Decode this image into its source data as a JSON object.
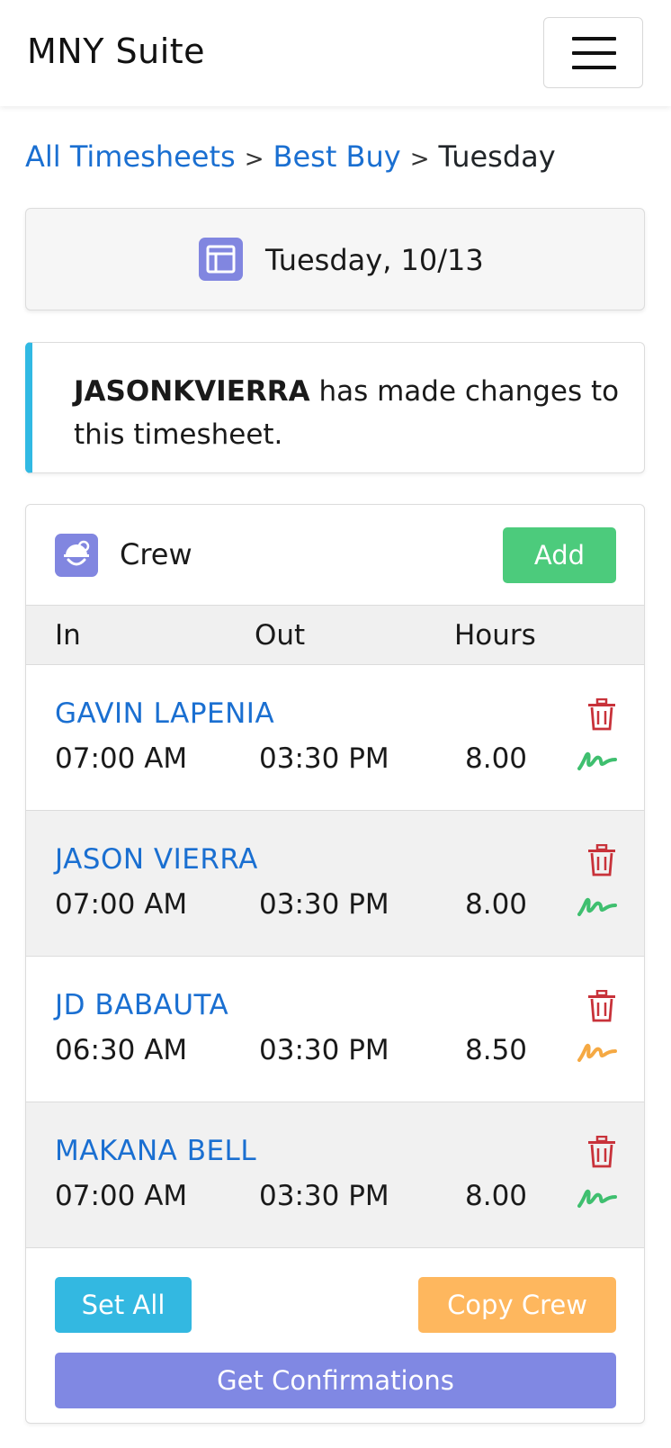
{
  "navbar": {
    "brand": "MNY Suite",
    "menu_icon": "hamburger-icon"
  },
  "breadcrumb": {
    "items": [
      "All Timesheets",
      "Best Buy",
      "Tuesday"
    ],
    "separator": ">"
  },
  "date_card": {
    "icon": "calendar-icon",
    "label": "Tuesday, 10/13"
  },
  "alert": {
    "user": "JASONKVIERRA",
    "message": " has made changes to this timesheet.",
    "accent_color": "#31b9e3"
  },
  "crew": {
    "title": "Crew",
    "icon": "worker-helmet-icon",
    "add_label": "Add",
    "columns": [
      "In",
      "Out",
      "Hours"
    ],
    "rows": [
      {
        "name": "GAVIN LAPENIA",
        "in": "07:00 AM",
        "out": "03:30 PM",
        "hours": "8.00",
        "signature_color": "#3fbf6f"
      },
      {
        "name": "JASON VIERRA",
        "in": "07:00 AM",
        "out": "03:30 PM",
        "hours": "8.00",
        "signature_color": "#3fbf6f"
      },
      {
        "name": "JD BABAUTA",
        "in": "06:30 AM",
        "out": "03:30 PM",
        "hours": "8.50",
        "signature_color": "#f5a943"
      },
      {
        "name": "MAKANA BELL",
        "in": "07:00 AM",
        "out": "03:30 PM",
        "hours": "8.00",
        "signature_color": "#3fbf6f"
      }
    ],
    "buttons": {
      "set_all": "Set All",
      "copy_crew": "Copy Crew",
      "get_confirmations": "Get Confirmations"
    }
  },
  "colors": {
    "link": "#1a6fd1",
    "add": "#4ccb7c",
    "set_all": "#33b8e1",
    "copy_crew": "#feb75e",
    "get_confirmations": "#8088e3",
    "delete": "#c8323a"
  }
}
